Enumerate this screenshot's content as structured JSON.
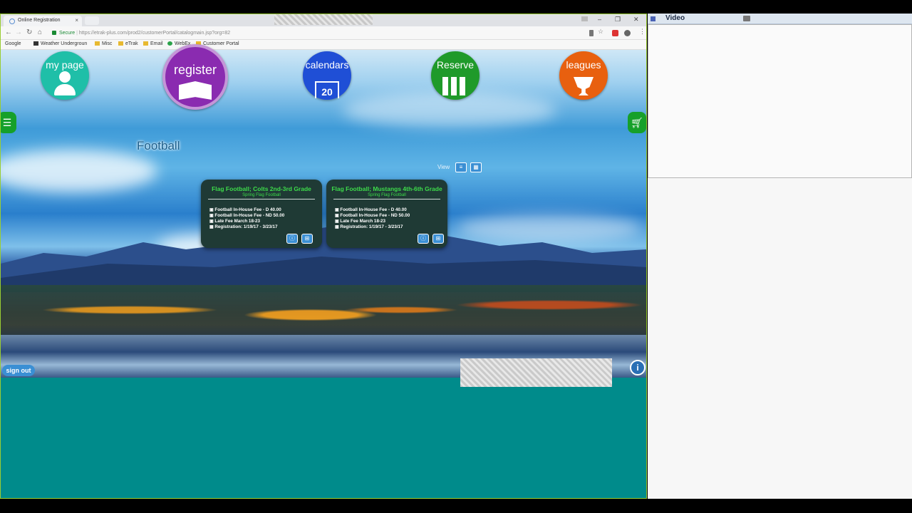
{
  "browser": {
    "tab_title": "Online Registration",
    "tab_close": "×",
    "url": "https://etrak-plus.com/prod2/customerPortal/catalogmain.jsp?org=82",
    "secure_label": "Secure",
    "window_controls": {
      "minimize": "–",
      "restore": "❐",
      "close": "✕"
    },
    "bookmarks": [
      "Google",
      "Weather Undergroun",
      "Misc",
      "eTrak",
      "Email",
      "WebEx",
      "Customer Portal"
    ]
  },
  "nav": {
    "items": [
      {
        "label": "my page",
        "icon": "person-icon",
        "color": "#1fbfa8"
      },
      {
        "label": "register",
        "icon": "book-icon",
        "color": "#8a2bb0"
      },
      {
        "label": "calendars",
        "icon": "calendar-icon",
        "color": "#1f4fd6",
        "glyph_text": "20"
      },
      {
        "label": "Reserve",
        "icon": "grid-hand-icon",
        "color": "#1f9a2a"
      },
      {
        "label": "leagues",
        "icon": "trophy-icon",
        "color": "#e8600f"
      }
    ]
  },
  "side": {
    "menu_icon": "hamburger-icon",
    "cart_icon": "cart-icon"
  },
  "catalog": {
    "title": "Football",
    "view_label": "View",
    "cards": [
      {
        "title": "Flag Football; Colts 2nd-3rd Grade",
        "subtitle": "Spring Flag Football",
        "lines": [
          "Football In-House Fee - D 40.00",
          "Football In-House Fee - ND 50.00",
          "Late Fee March 18-23"
        ],
        "registration": "Registration: 1/19/17 - 3/23/17"
      },
      {
        "title": "Flag Football; Mustangs 4th-6th Grade",
        "subtitle": "Spring Flag Football",
        "lines": [
          "Football In-House Fee - D 40.00",
          "Football In-House Fee - ND 50.00",
          "Late Fee March 18-23"
        ],
        "registration": "Registration: 1/19/17 - 3/23/17"
      }
    ]
  },
  "footer": {
    "signout": "sign out",
    "info": "i"
  },
  "video_panel": {
    "title": "Video"
  },
  "colors": {
    "accent": "#3a8fd4",
    "page_bg": "#008b8b",
    "card_bg": "#1f3a35",
    "card_title": "#3ddb4a",
    "green_btn": "#16a02a"
  }
}
